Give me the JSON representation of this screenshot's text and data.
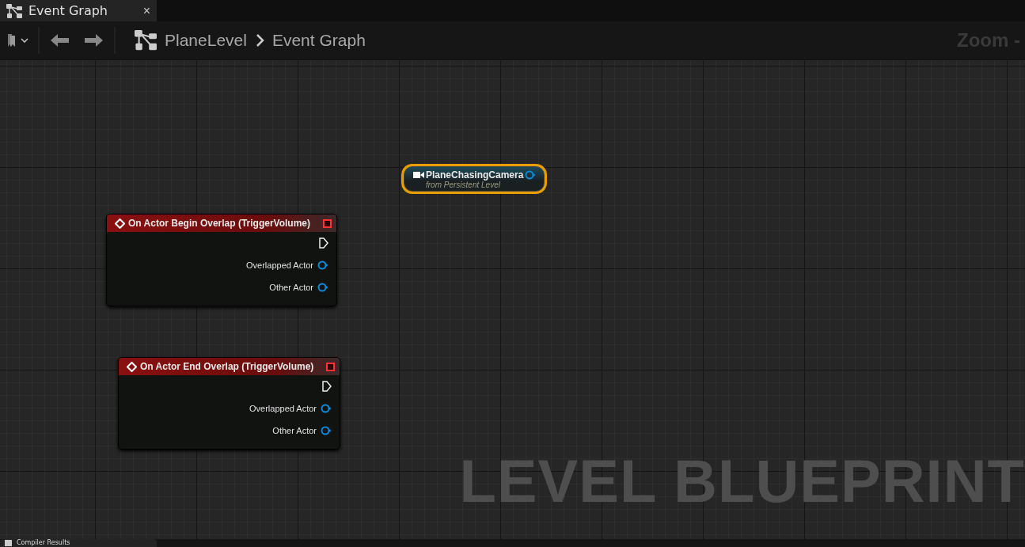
{
  "tab": {
    "title": "Event Graph",
    "close": "×"
  },
  "breadcrumb": [
    "PlaneLevel",
    "Event Graph"
  ],
  "zoom_label": "Zoom -",
  "nodes": [
    {
      "kind": "actor_ref",
      "title": "PlaneChasingCamera",
      "subtitle": "from Persistent Level",
      "selected": true
    },
    {
      "kind": "event",
      "title": "On Actor Begin Overlap (TriggerVolume)",
      "selected": false,
      "pins": [
        {
          "kind": "exec"
        },
        {
          "kind": "object",
          "label": "Overlapped Actor"
        },
        {
          "kind": "object",
          "label": "Other Actor"
        }
      ]
    },
    {
      "kind": "event",
      "title": "On Actor End Overlap (TriggerVolume)",
      "selected": false,
      "pins": [
        {
          "kind": "exec"
        },
        {
          "kind": "object",
          "label": "Overlapped Actor"
        },
        {
          "kind": "object",
          "label": "Other Actor"
        }
      ]
    }
  ],
  "watermark": "LEVEL BLUEPRINT",
  "bottom_tab": {
    "title": "Compiler Results"
  }
}
